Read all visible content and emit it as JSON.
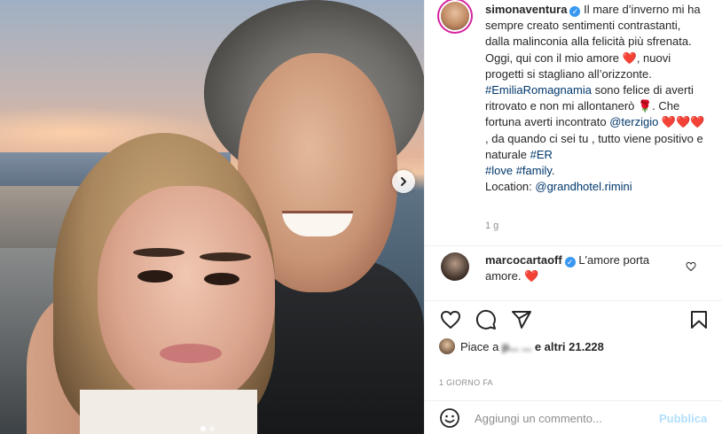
{
  "post": {
    "carousel": {
      "total": 2,
      "active": 1
    }
  },
  "header": {
    "username": "simonaventura",
    "verified": "✓"
  },
  "caption": {
    "text1": " Il mare d’inverno mi ha sempre creato sentimenti contrastanti, dalla malinconia alla felicità più sfrenata. Oggi, qui con il mio amore ",
    "heart": "❤️",
    "text2": ", nuovi progetti si stagliano all’orizzonte.",
    "hashtag1": "#EmiliaRomagnamia",
    "text3": " sono felice di averti ritrovato e non mi allontanerò ",
    "rose": "🌹",
    "text4": ". Che fortuna averti incontrato ",
    "mention1": "@terzigio",
    "hearts": " ❤️❤️❤️ ",
    "text5": ", da quando ci sei tu , tutto viene positivo e naturale ",
    "hashtag2": "#ER",
    "hashtag3": "#love",
    "hashtag4": "#family",
    "text6": ".",
    "location_label": "Location: ",
    "location_mention": "@grandhotel.rimini",
    "time": "1 g"
  },
  "comment": {
    "username": "marcocartaoff",
    "verified": "✓",
    "text": " L'amore porta amore. ",
    "heart": "❤️"
  },
  "likes": {
    "prefix": "Piace a ",
    "blurred": "p... ...",
    "suffix": " e altri 21.228"
  },
  "date": "1 GIORNO FA",
  "add_comment": {
    "placeholder": "Aggiungi un commento...",
    "publish": "Pubblica"
  },
  "icons": {
    "like": "heart-outline-icon",
    "comment": "speech-bubble-icon",
    "share": "paper-plane-icon",
    "save": "bookmark-icon",
    "emoji": "smiley-icon",
    "next": "chevron-right-icon"
  },
  "colors": {
    "link": "#00376b",
    "verified": "#3897f0",
    "heart": "#e0245e",
    "publish_disabled": "#b2dffc",
    "muted": "#8e8e8e"
  }
}
